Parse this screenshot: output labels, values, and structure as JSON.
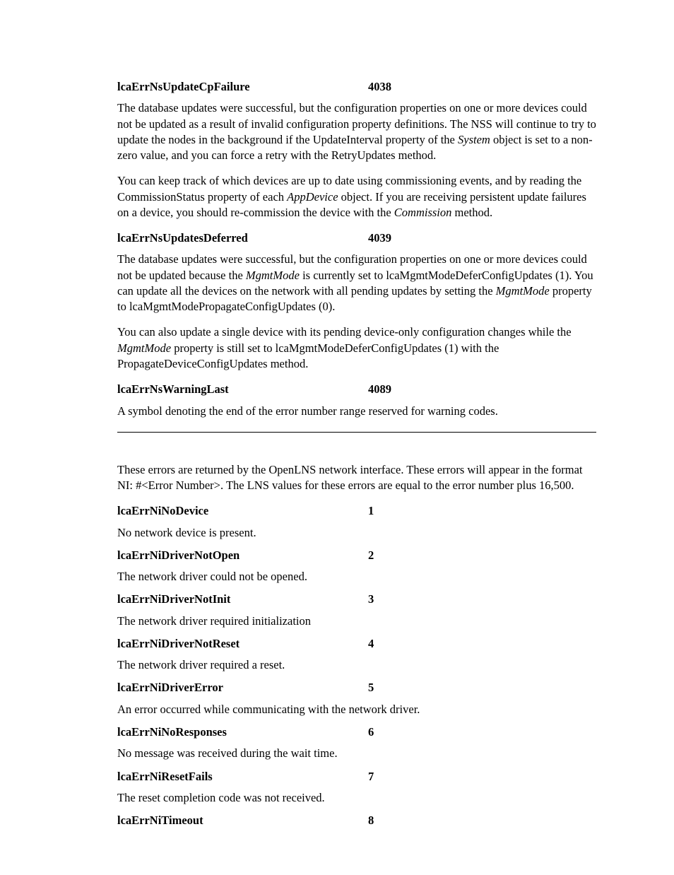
{
  "sectionA": {
    "entries": [
      {
        "name": "lcaErrNsUpdateCpFailure",
        "code": "4038",
        "paragraphs": [
          [
            {
              "t": "The database updates were successful, but the configuration properties on one or more devices could not be updated as a result of invalid configuration property definitions. The NSS will continue to try to update the nodes in the background if the UpdateInterval property of the "
            },
            {
              "t": "System",
              "i": true
            },
            {
              "t": "  object is set to a non-zero value, and you can force a retry with the RetryUpdates method."
            }
          ],
          [
            {
              "t": "You can keep track of which devices are up to date using commissioning events, and by reading the CommissionStatus property of each "
            },
            {
              "t": "AppDevice",
              "i": true
            },
            {
              "t": "   object.  If you are receiving persistent update failures on a device, you should re-commission the device with the "
            },
            {
              "t": "Commission",
              "i": true
            },
            {
              "t": " method."
            }
          ]
        ]
      },
      {
        "name": "lcaErrNsUpdatesDeferred",
        "code": "4039",
        "paragraphs": [
          [
            {
              "t": "The database updates were successful, but the configuration properties on one or more devices could not be updated because the "
            },
            {
              "t": "MgmtMode",
              "i": true
            },
            {
              "t": "  is currently set to lcaMgmtModeDeferConfigUpdates (1). You can update all the devices on the network with all pending updates by setting the "
            },
            {
              "t": "MgmtMode",
              "i": true
            },
            {
              "t": "  property to lcaMgmtModePropagateConfigUpdates (0)."
            }
          ],
          [
            {
              "t": "You can also update a single device with its pending device-only configuration changes while the "
            },
            {
              "t": "MgmtMode",
              "i": true
            },
            {
              "t": "  property is still set to lcaMgmtModeDeferConfigUpdates (1) with the PropagateDeviceConfigUpdates method."
            }
          ]
        ]
      },
      {
        "name": "lcaErrNsWarningLast",
        "code": "4089",
        "paragraphs": [
          [
            {
              "t": "A symbol denoting the end of the error number range reserved for warning codes."
            }
          ]
        ]
      }
    ]
  },
  "sectionB": {
    "intro": [
      {
        "t": "These errors are returned by the OpenLNS network interface. These errors will appear in the format NI: #<Error Number>. The LNS values for these errors are equal to the error number plus 16,500."
      }
    ],
    "entries": [
      {
        "name": "lcaErrNiNoDevice",
        "code": "1",
        "desc": "No network device is present."
      },
      {
        "name": "lcaErrNiDriverNotOpen",
        "code": "2",
        "desc": "The network driver could not be opened."
      },
      {
        "name": "lcaErrNiDriverNotInit",
        "code": "3",
        "desc": "The network driver required initialization"
      },
      {
        "name": "lcaErrNiDriverNotReset",
        "code": "4",
        "desc": "The network driver required a reset."
      },
      {
        "name": "lcaErrNiDriverError",
        "code": "5",
        "desc": "An error occurred while communicating with the network driver."
      },
      {
        "name": "lcaErrNiNoResponses",
        "code": "6",
        "desc": "No message was received during the wait time."
      },
      {
        "name": "lcaErrNiResetFails",
        "code": "7",
        "desc": "The reset completion code was not received."
      },
      {
        "name": "lcaErrNiTimeout",
        "code": "8",
        "desc": ""
      }
    ]
  }
}
